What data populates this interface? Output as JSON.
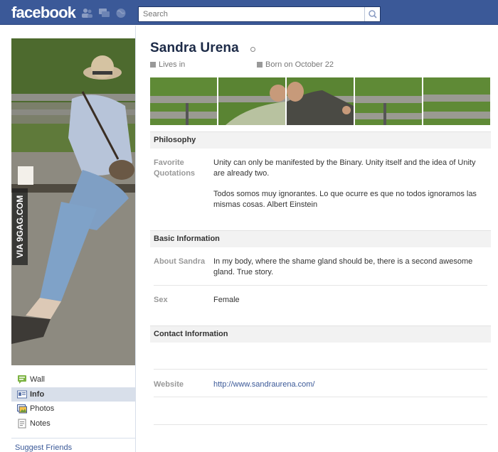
{
  "header": {
    "logo": "facebook",
    "search_placeholder": "Search"
  },
  "profile": {
    "name": "Sandra Urena",
    "lives_in": "Lives in",
    "born": "Born on October 22",
    "watermark": "VIA 9GAG.COM"
  },
  "nav": {
    "items": [
      {
        "label": "Wall",
        "icon": "wall-icon"
      },
      {
        "label": "Info",
        "icon": "info-icon",
        "active": true
      },
      {
        "label": "Photos",
        "icon": "photos-icon"
      },
      {
        "label": "Notes",
        "icon": "notes-icon"
      }
    ],
    "suggest": "Suggest Friends"
  },
  "sections": {
    "philosophy": {
      "title": "Philosophy",
      "quote_label": "Favorite Quotations",
      "quote_1": "Unity can only be manifested by the Binary. Unity itself and the idea of Unity are already two.",
      "quote_2": "Todos somos muy ignorantes. Lo que ocurre es que no todos ignoramos las mismas cosas. Albert Einstein"
    },
    "basic": {
      "title": "Basic Information",
      "about_label": "About Sandra",
      "about_value": "In my body, where the shame gland should be, there is a second awesome gland. True story.",
      "sex_label": "Sex",
      "sex_value": "Female"
    },
    "contact": {
      "title": "Contact Information",
      "website_label": "Website",
      "website_value": "http://www.sandraurena.com/"
    }
  },
  "colors": {
    "brand": "#3b5998",
    "link": "#3b5998",
    "nav_active": "#d8dfea"
  }
}
